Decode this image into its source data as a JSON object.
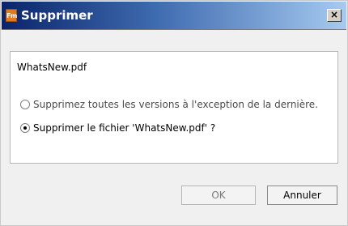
{
  "window": {
    "title": "Supprimer",
    "app_icon_text": "Fm",
    "close_glyph": "×",
    "titlebar_gradient": [
      "#0a246a",
      "#3f6bb0",
      "#a6caf0"
    ]
  },
  "content": {
    "filename": "WhatsNew.pdf",
    "options": [
      {
        "label": "Supprimez toutes les versions à l'exception de la dernière.",
        "checked": false
      },
      {
        "label": "Supprimer le fichier 'WhatsNew.pdf' ?",
        "checked": true
      }
    ]
  },
  "buttons": {
    "ok_label": "OK",
    "cancel_label": "Annuler"
  },
  "icons": {
    "app": "framemaker-app-icon",
    "close": "close-icon"
  }
}
